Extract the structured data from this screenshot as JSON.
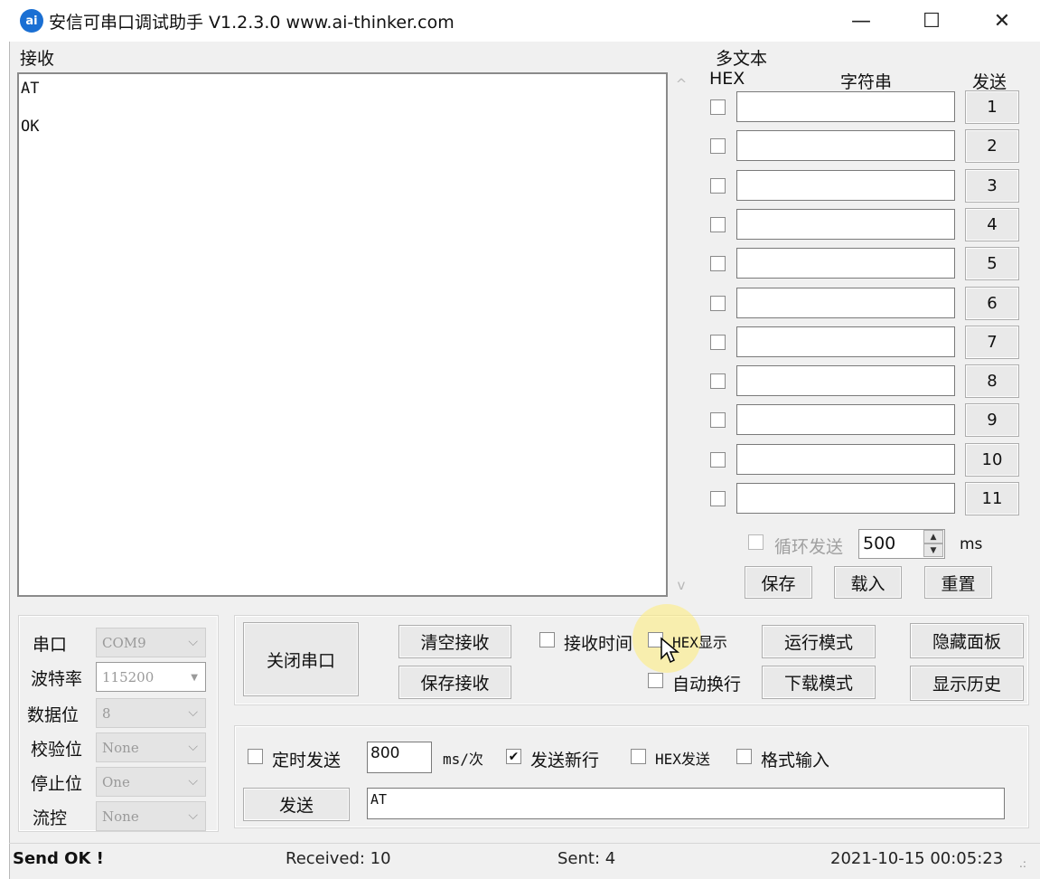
{
  "window": {
    "title": "安信可串口调试助手 V1.2.3.0    www.ai-thinker.com",
    "icon_text": "ai",
    "minimize": "—",
    "maximize": "☐",
    "close": "✕"
  },
  "receive": {
    "label": "接收",
    "lines": [
      "AT",
      "OK"
    ]
  },
  "multitext": {
    "title": "多文本",
    "col_hex": "HEX",
    "col_string": "字符串",
    "col_send": "发送",
    "rows": [
      {
        "send_label": "1",
        "hex_checked": false,
        "value": ""
      },
      {
        "send_label": "2",
        "hex_checked": false,
        "value": ""
      },
      {
        "send_label": "3",
        "hex_checked": false,
        "value": ""
      },
      {
        "send_label": "4",
        "hex_checked": false,
        "value": ""
      },
      {
        "send_label": "5",
        "hex_checked": false,
        "value": ""
      },
      {
        "send_label": "6",
        "hex_checked": false,
        "value": ""
      },
      {
        "send_label": "7",
        "hex_checked": false,
        "value": ""
      },
      {
        "send_label": "8",
        "hex_checked": false,
        "value": ""
      },
      {
        "send_label": "9",
        "hex_checked": false,
        "value": ""
      },
      {
        "send_label": "10",
        "hex_checked": false,
        "value": ""
      },
      {
        "send_label": "11",
        "hex_checked": false,
        "value": ""
      }
    ],
    "loop_send_label": "循环发送",
    "loop_send_checked": false,
    "interval_value": "500",
    "interval_unit": "ms",
    "save_label": "保存",
    "load_label": "载入",
    "reset_label": "重置"
  },
  "port_settings": {
    "port_label": "串口",
    "port_value": "COM9",
    "baud_label": "波特率",
    "baud_value": "115200",
    "databits_label": "数据位",
    "databits_value": "8",
    "parity_label": "校验位",
    "parity_value": "None",
    "stopbits_label": "停止位",
    "stopbits_value": "One",
    "flow_label": "流控",
    "flow_value": "None"
  },
  "controls": {
    "close_port_label": "关闭串口",
    "clear_receive_label": "清空接收",
    "save_receive_label": "保存接收",
    "receive_time_label": "接收时间",
    "receive_time_checked": false,
    "hex_display_label": "HEX显示",
    "hex_display_checked": false,
    "auto_wrap_label": "自动换行",
    "auto_wrap_checked": false,
    "run_mode_label": "运行模式",
    "download_mode_label": "下载模式",
    "hide_panel_label": "隐藏面板",
    "show_history_label": "显示历史"
  },
  "send_area": {
    "timed_send_label": "定时发送",
    "timed_send_checked": false,
    "timed_interval": "800",
    "timed_unit": "ms/次",
    "send_newline_label": "发送新行",
    "send_newline_checked": true,
    "hex_send_label": "HEX发送",
    "hex_send_checked": false,
    "format_input_label": "格式输入",
    "format_input_checked": false,
    "send_button_label": "发送",
    "send_text": "AT"
  },
  "status_bar": {
    "message": "Send OK !",
    "received": "Received: 10",
    "sent": "Sent: 4",
    "datetime": "2021-10-15 00:05:23"
  }
}
